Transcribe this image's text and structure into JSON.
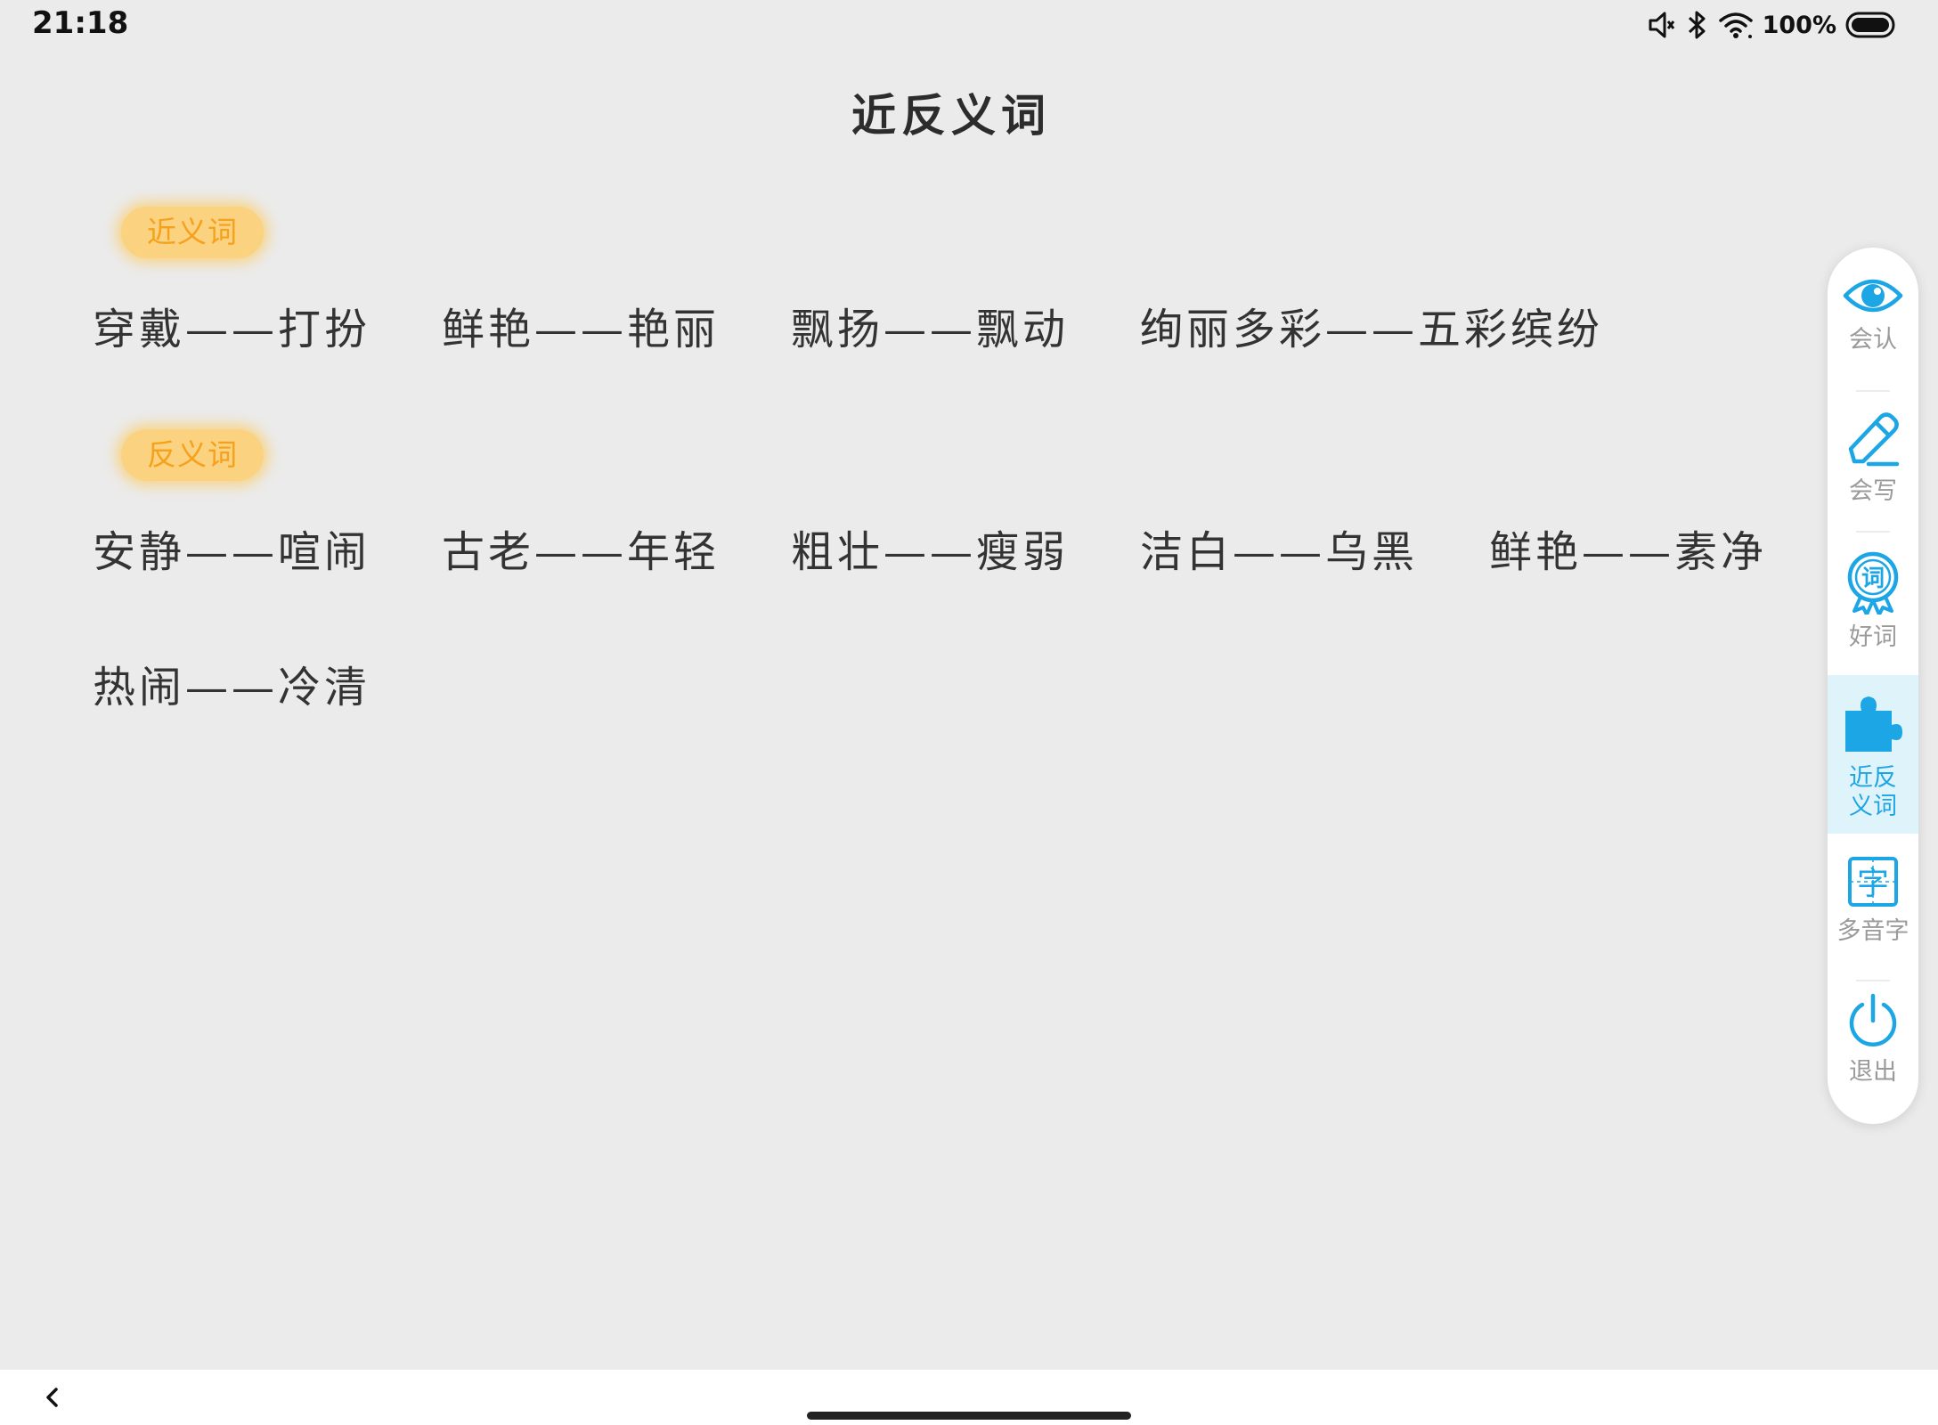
{
  "status_bar": {
    "time": "21:18",
    "battery_percent": "100%",
    "icons": [
      "mute-icon",
      "bluetooth-icon",
      "wifi-icon",
      "battery-icon"
    ]
  },
  "page": {
    "title": "近反义词"
  },
  "synonyms": {
    "label": "近义词",
    "pairs": [
      "穿戴——打扮",
      "鲜艳——艳丽",
      "飘扬——飘动",
      "绚丽多彩——五彩缤纷"
    ]
  },
  "antonyms": {
    "label": "反义词",
    "pairs": [
      "安静——喧闹",
      "古老——年轻",
      "粗壮——瘦弱",
      "洁白——乌黑",
      "鲜艳——素净",
      "热闹——冷清"
    ]
  },
  "toolbar": {
    "items": [
      {
        "label": "会认",
        "icon": "eye-icon"
      },
      {
        "label": "会写",
        "icon": "pencil-icon"
      },
      {
        "label": "好词",
        "icon": "word-badge-icon"
      },
      {
        "label": "近反义词",
        "icon": "puzzle-icon",
        "active": true
      },
      {
        "label": "多音字",
        "icon": "character-icon"
      },
      {
        "label": "退出",
        "icon": "power-icon"
      }
    ]
  },
  "colors": {
    "accent": "#1da6e6",
    "badge_bg": "#fbd280",
    "badge_text": "#f5a11b",
    "background": "#ebebeb"
  }
}
